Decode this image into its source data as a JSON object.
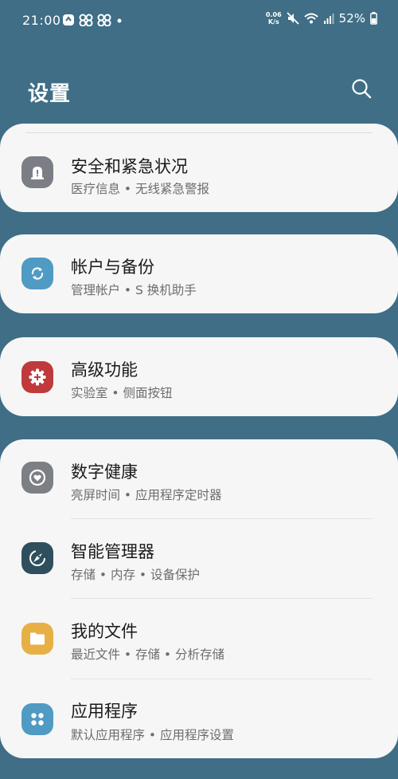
{
  "status_bar": {
    "time": "21:00",
    "net_speed_value": "0.06",
    "net_speed_unit": "K/s",
    "battery": "52%"
  },
  "header": {
    "title": "设置"
  },
  "items": [
    {
      "title": "安全和紧急状况",
      "subtitle": "医疗信息 • 无线紧急警报",
      "icon": "siren-icon",
      "color": "#7b7f85"
    },
    {
      "title": "帐户与备份",
      "subtitle": "管理帐户 • S 换机助手",
      "icon": "sync-icon",
      "color": "#4f9bc4"
    },
    {
      "title": "高级功能",
      "subtitle": "实验室 • 侧面按钮",
      "icon": "gear-plus-icon",
      "color": "#c0393b"
    },
    {
      "title": "数字健康",
      "subtitle": "亮屏时间 • 应用程序定时器",
      "icon": "heart-circle-icon",
      "color": "#7c8085"
    },
    {
      "title": "智能管理器",
      "subtitle": "存储 • 内存 • 设备保护",
      "icon": "rocket-icon",
      "color": "#2f4f5e"
    },
    {
      "title": "我的文件",
      "subtitle": "最近文件 • 存储 • 分析存储",
      "icon": "folder-icon",
      "color": "#e7b046"
    },
    {
      "title": "应用程序",
      "subtitle": "默认应用程序 • 应用程序设置",
      "icon": "apps-grid-icon",
      "color": "#4f9bc4"
    }
  ]
}
